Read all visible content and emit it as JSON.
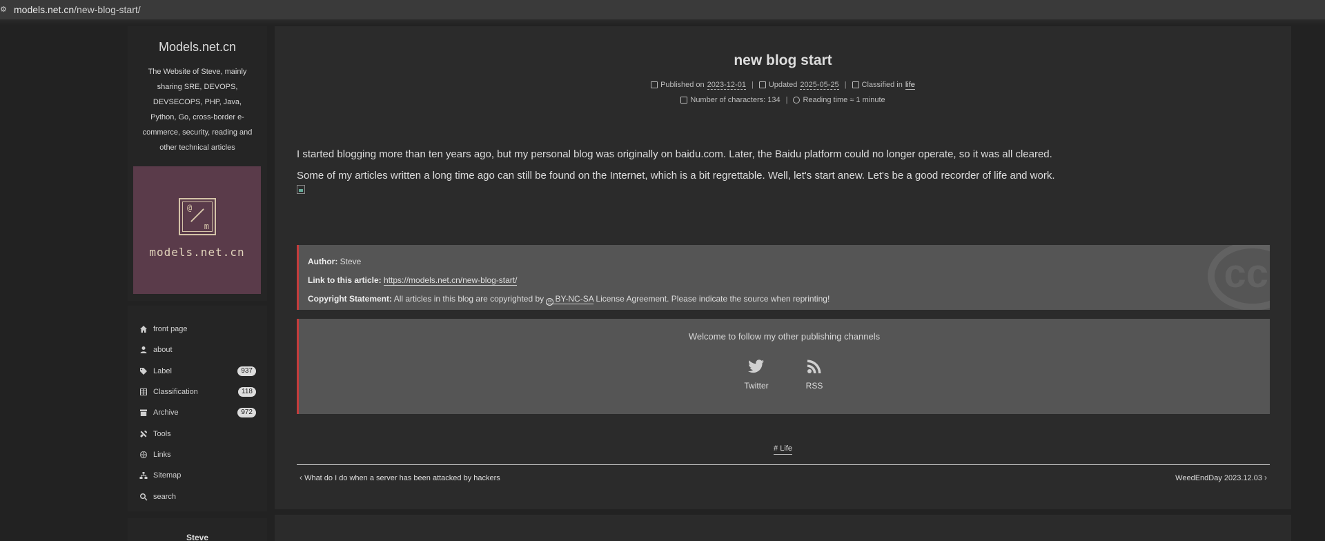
{
  "browser": {
    "url_host": "models.net.cn",
    "url_path": "/new-blog-start/"
  },
  "sidebar": {
    "site_title": "Models.net.cn",
    "site_description": "The Website of Steve, mainly sharing SRE, DEVOPS, DEVSECOPS, PHP, Java, Python, Go, cross-border e-commerce, security, reading and other technical articles",
    "logo_text": "models.net.cn",
    "logo_glyph_top": "@",
    "logo_glyph_bottom": "m",
    "nav": [
      {
        "label": "front page",
        "icon": "home-icon"
      },
      {
        "label": "about",
        "icon": "user-icon"
      },
      {
        "label": "Label",
        "icon": "tags-icon",
        "badge": "937"
      },
      {
        "label": "Classification",
        "icon": "grid-icon",
        "badge": "118"
      },
      {
        "label": "Archive",
        "icon": "archive-icon",
        "badge": "972"
      },
      {
        "label": "Tools",
        "icon": "tools-icon"
      },
      {
        "label": "Links",
        "icon": "globe-icon"
      },
      {
        "label": "Sitemap",
        "icon": "sitemap-icon"
      },
      {
        "label": "search",
        "icon": "search-icon"
      }
    ],
    "author_name": "Steve"
  },
  "post": {
    "title": "new blog start",
    "published_label": "Published on",
    "published_date": "2023-12-01",
    "updated_label": "Updated",
    "updated_date": "2025-05-25",
    "classified_label": "Classified in",
    "category": "life",
    "chars_label": "Number of characters: 134",
    "reading_label": "Reading time ≈ 1 minute",
    "paragraphs": [
      "I started blogging more than ten years ago, but my personal blog was originally on baidu.com. Later, the Baidu platform could no longer operate, so it was all cleared.",
      "Some of my articles written a long time ago can still be found on the Internet, which is a bit regrettable. Well, let's start anew. Let's be a good recorder of life and work."
    ]
  },
  "copyright": {
    "author_label": "Author:",
    "author_value": "Steve",
    "link_label": "Link to this article:",
    "link_value": "https://models.net.cn/new-blog-start/",
    "statement_label": "Copyright Statement:",
    "statement_before": "All articles in this blog are copyrighted by",
    "license": "BY-NC-SA",
    "statement_after": "License Agreement. Please indicate the source when reprinting!",
    "cc_icon_text": "cc",
    "watermark_text": "cc"
  },
  "follow": {
    "title": "Welcome to follow my other publishing channels",
    "items": [
      {
        "label": "Twitter",
        "icon": "twitter-icon"
      },
      {
        "label": "RSS",
        "icon": "rss-icon"
      }
    ]
  },
  "tags": [
    "# Life"
  ],
  "post_nav": {
    "prev": "What do I do when a server has been attacked by hackers",
    "next": "WeedEndDay 2023.12.03"
  },
  "colors": {
    "accent_border": "#c43c3c",
    "page_bg": "#222222",
    "panel_bg": "#2b2b2b",
    "logo_bg": "#5a3b4a"
  }
}
